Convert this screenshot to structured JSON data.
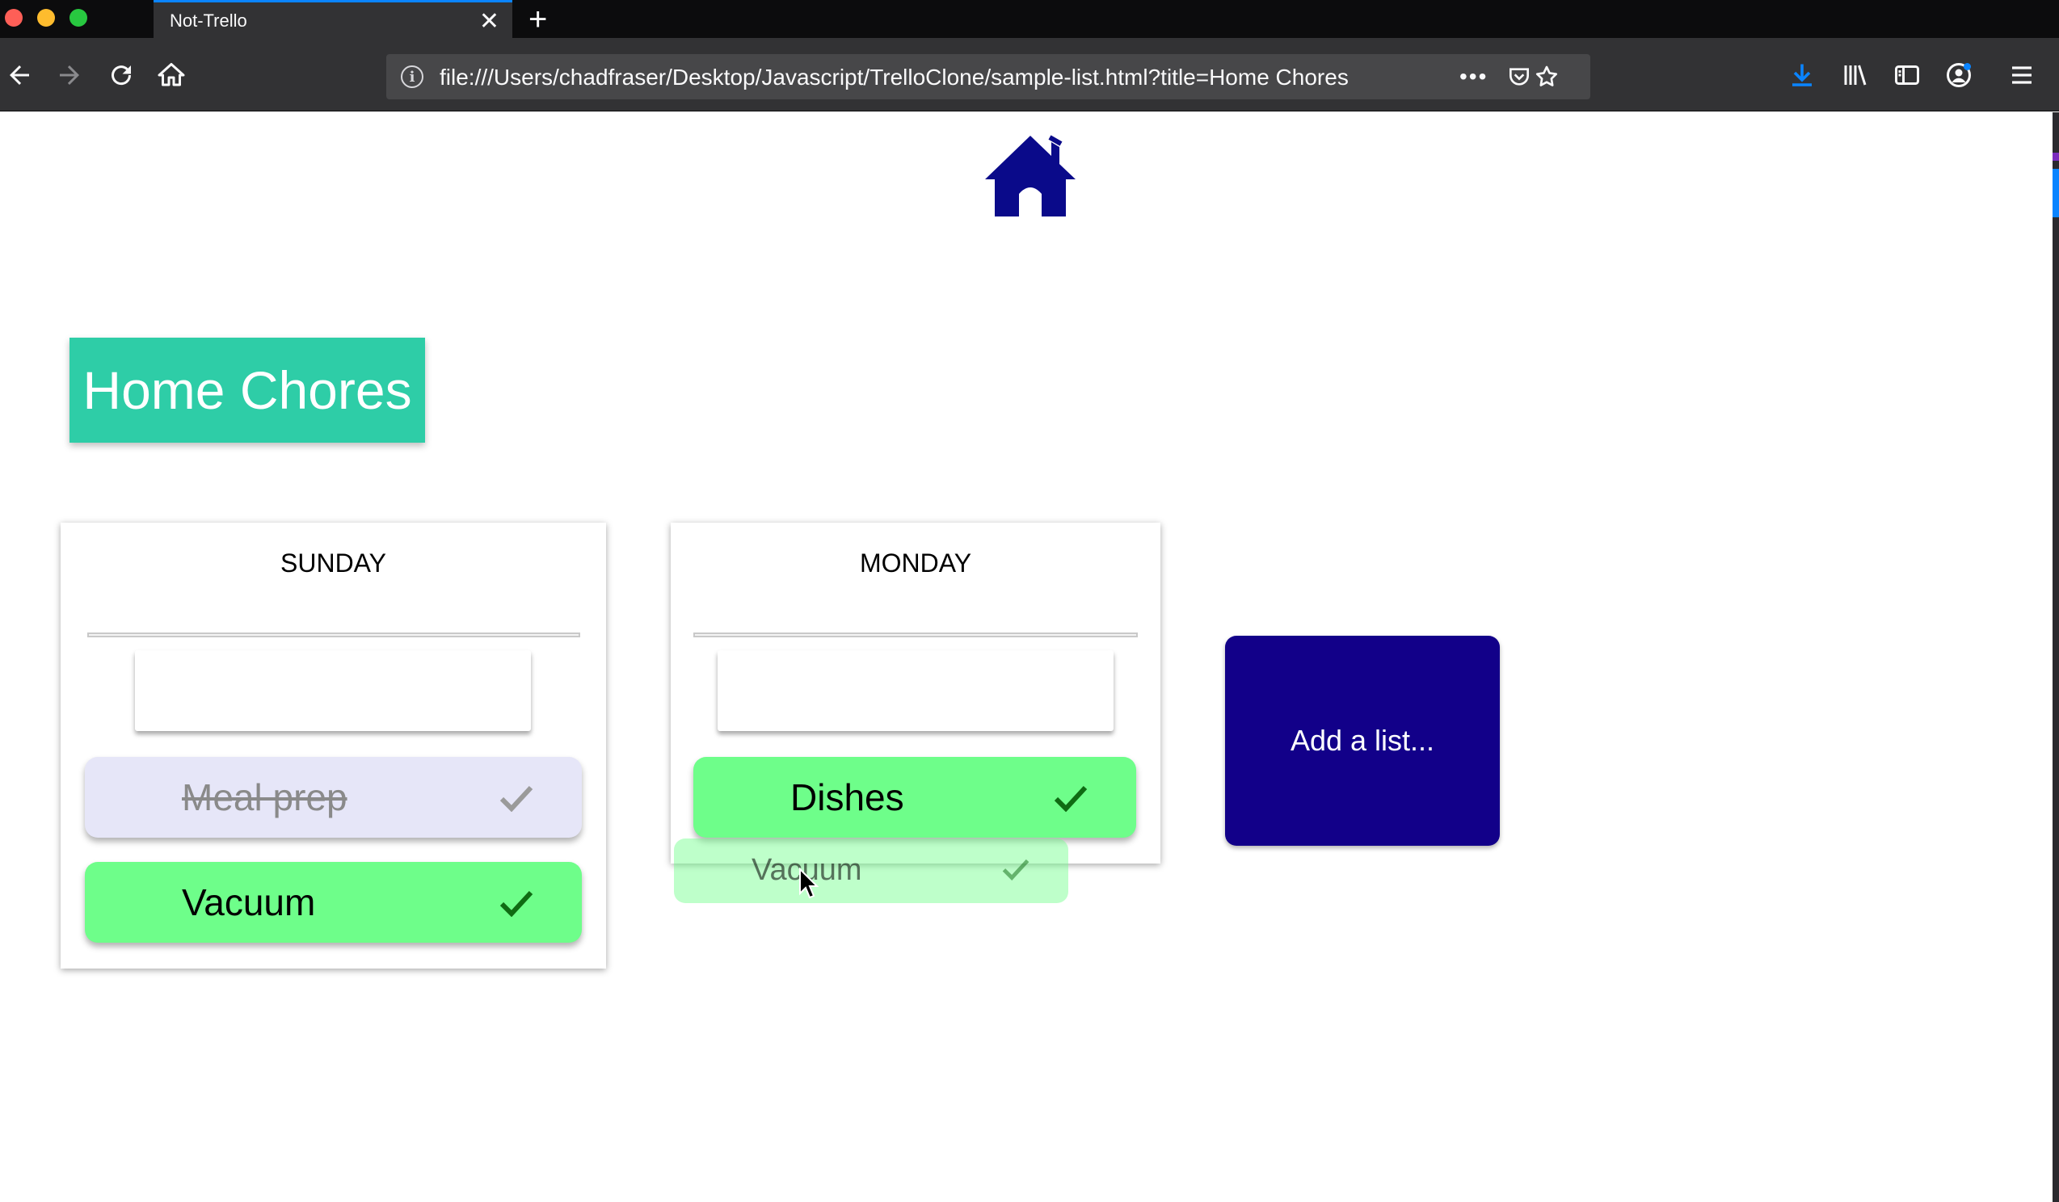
{
  "browser": {
    "tab_title": "Not-Trello",
    "tab_close": "✕",
    "new_tab": "+",
    "url": "file:///Users/chadfraser/Desktop/Javascript/TrelloClone/sample-list.html?title=Home Chores",
    "url_info": "i",
    "page_actions": "•••"
  },
  "page": {
    "home_icon": "house-icon",
    "board_title": "Home Chores",
    "lists": [
      {
        "header": "SUNDAY",
        "input_value": "",
        "cards": [
          {
            "text": "Meal prep",
            "status": "completed"
          },
          {
            "text": "Vacuum",
            "status": "active"
          }
        ]
      },
      {
        "header": "MONDAY",
        "input_value": "",
        "cards": [
          {
            "text": "Dishes",
            "status": "active"
          }
        ]
      }
    ],
    "drag_ghost": {
      "text": "Vacuum"
    },
    "add_list_label": "Add a list..."
  },
  "colors": {
    "title_bg": "#2ecda7",
    "card_active": "#6efe8a",
    "card_done": "#e6e6f8",
    "add_list_bg": "#120089",
    "home_icon": "#0a0a8a",
    "check_active": "#0f6b13"
  }
}
